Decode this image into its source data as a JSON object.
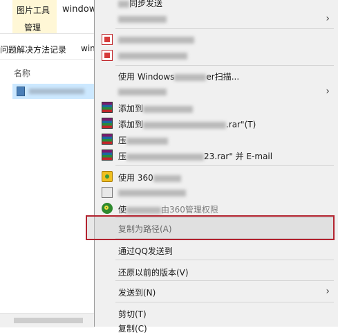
{
  "ribbon": {
    "context_tab_title": "图片工具",
    "context_tab_sub": "管理",
    "window_title": "window"
  },
  "address": {
    "crumb1": "问题解决方法记录",
    "crumb2": "win"
  },
  "file_list": {
    "column_name": "名称"
  },
  "menu": {
    "top_item": "同步发送",
    "item_wps_pdf1": "",
    "item_wps_pdf2": "",
    "item_defender": "使用 Windows",
    "item_defender_tail": "er扫描...",
    "item_open_with": "打开方式(H)",
    "item_add_archive": "添加到",
    "item_add_to": "添加到",
    "item_add_to_tail": ".rar\"(T)",
    "item_compress_email": "压",
    "item_compress_to_email": "压",
    "item_compress_to_email_tail": "23.rar\" 并 E-mail",
    "item_360": "使用 360",
    "item_360_delete": "",
    "item_360_scan": "使",
    "item_360_scan_tail": "由360管理权限",
    "item_copy_path": "复制为路径(A)",
    "item_send_qq": "通过QQ发送到",
    "item_restore": "还原以前的版本(V)",
    "item_send_to": "发送到(N)",
    "item_cut": "剪切(T)",
    "item_copy": "复制(C)"
  },
  "colors": {
    "menu_bg": "#f0f0f0",
    "highlight_border": "#b3232f",
    "selection": "#cce8ff",
    "context_tab": "#fff7d6"
  }
}
